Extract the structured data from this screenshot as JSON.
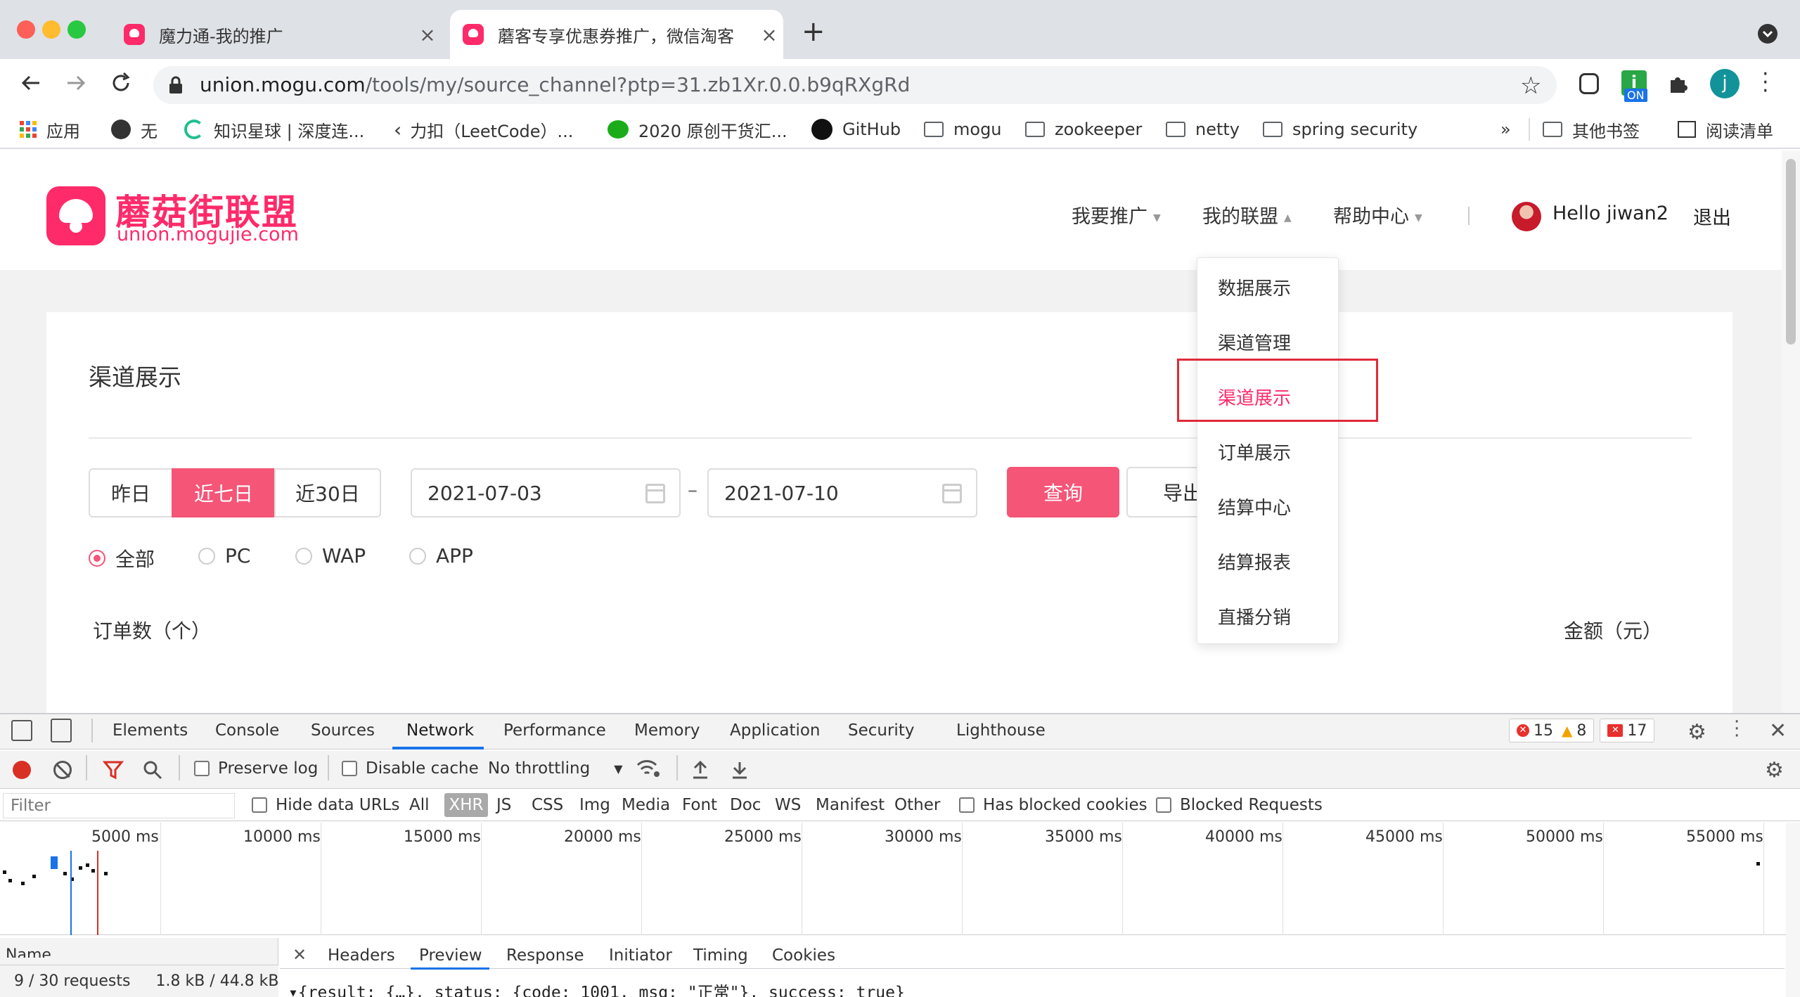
{
  "browser": {
    "tabs": [
      {
        "title": "魔力通-我的推广"
      },
      {
        "title": "蘑客专享优惠券推广，微信淘客"
      }
    ],
    "address": {
      "host": "union.mogu.com",
      "path": "/tools/my/source_channel?ptp=31.zb1Xr.0.0.b9qRXgRd"
    },
    "extension_badge": "ON",
    "profile_initial": "j",
    "bookmarks": [
      {
        "label": "应用",
        "icon": "apps-grid-icon"
      },
      {
        "label": "无",
        "icon": "globe-icon"
      },
      {
        "label": "知识星球 | 深度连...",
        "icon": "loading-ring-icon"
      },
      {
        "label": "力扣（LeetCode）...",
        "icon": "leetcode-icon"
      },
      {
        "label": "2020 原创干货汇...",
        "icon": "wechat-icon"
      },
      {
        "label": "GitHub",
        "icon": "github-icon"
      },
      {
        "label": "mogu",
        "icon": "folder-icon"
      },
      {
        "label": "zookeeper",
        "icon": "folder-icon"
      },
      {
        "label": "netty",
        "icon": "folder-icon"
      },
      {
        "label": "spring security",
        "icon": "folder-icon"
      }
    ],
    "bookmarks_overflow": "»",
    "other_bookmarks": "其他书签",
    "reading_list": "阅读清单"
  },
  "site": {
    "logo_cn": "蘑菇街联盟",
    "logo_en": "union.mogujie.com",
    "nav": [
      {
        "label": "我要推广"
      },
      {
        "label": "我的联盟"
      },
      {
        "label": "帮助中心"
      }
    ],
    "greeting": "Hello jiwan2",
    "logout": "退出",
    "brand_color": "#ff2a6a"
  },
  "dropdown": {
    "items": [
      {
        "label": "数据展示"
      },
      {
        "label": "渠道管理"
      },
      {
        "label": "渠道展示",
        "selected": true
      },
      {
        "label": "订单展示"
      },
      {
        "label": "结算中心"
      },
      {
        "label": "结算报表"
      },
      {
        "label": "直播分销"
      }
    ]
  },
  "main": {
    "title": "渠道展示",
    "ranges": [
      {
        "label": "昨日"
      },
      {
        "label": "近七日",
        "active": true
      },
      {
        "label": "近30日"
      }
    ],
    "start_date": "2021-07-03",
    "date_separator": "–",
    "end_date": "2021-07-10",
    "query_label": "查询",
    "export_label": "导出",
    "platforms": [
      {
        "label": "全部",
        "selected": true
      },
      {
        "label": "PC"
      },
      {
        "label": "WAP"
      },
      {
        "label": "APP"
      }
    ],
    "orders_label": "订单数（个）",
    "amount_label": "金额（元）"
  },
  "devtools": {
    "tabs": [
      "Elements",
      "Console",
      "Sources",
      "Network",
      "Performance",
      "Memory",
      "Application",
      "Security",
      "Lighthouse"
    ],
    "active_tab": "Network",
    "errors": "15",
    "warnings": "8",
    "issues": "17",
    "toolbar": {
      "preserve_log": "Preserve log",
      "disable_cache": "Disable cache",
      "throttling": "No throttling"
    },
    "filter": {
      "placeholder": "Filter",
      "hide_data_urls": "Hide data URLs",
      "types": [
        "All",
        "XHR",
        "JS",
        "CSS",
        "Img",
        "Media",
        "Font",
        "Doc",
        "WS",
        "Manifest",
        "Other"
      ],
      "active_type": "XHR",
      "has_blocked_cookies": "Has blocked cookies",
      "blocked_requests": "Blocked Requests"
    },
    "timeline_ticks": [
      "5000 ms",
      "10000 ms",
      "15000 ms",
      "20000 ms",
      "25000 ms",
      "30000 ms",
      "35000 ms",
      "40000 ms",
      "45000 ms",
      "50000 ms",
      "55000 ms"
    ],
    "name_header": "Name",
    "requests": "9 / 30 requests",
    "transferred": "1.8 kB / 44.8 kB",
    "detail_tabs": [
      "Headers",
      "Preview",
      "Response",
      "Initiator",
      "Timing",
      "Cookies"
    ],
    "active_detail_tab": "Preview",
    "preview": "▾{result: {…}, status: {code: 1001, msg: \"正常\"}, success: true}"
  }
}
